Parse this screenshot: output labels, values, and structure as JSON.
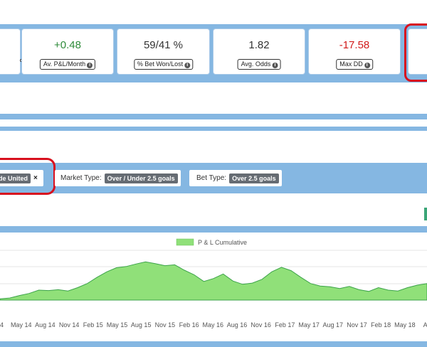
{
  "stats": [
    {
      "value": "",
      "label": ""
    },
    {
      "value": "+0.48",
      "label": "Av. P&L/Month",
      "tone": "green"
    },
    {
      "value": "59/41 %",
      "label": "% Bet Won/Lost",
      "tone": "neutral"
    },
    {
      "value": "1.82",
      "label": "Avg. Odds",
      "tone": "neutral"
    },
    {
      "value": "-17.58",
      "label": "Max DD",
      "tone": "red"
    }
  ],
  "filters": {
    "team": {
      "value": "de United",
      "remove": "×"
    },
    "market": {
      "label": "Market Type:",
      "value": "Over / Under 2.5 goals"
    },
    "bet": {
      "label": "Bet Type:",
      "value": "Over 2.5 goals"
    }
  },
  "colors": {
    "accent": "#85b7e2",
    "area_fill": "#90e079",
    "area_stroke": "#3ca34a",
    "positive": "#2e8b3a",
    "negative": "#d11a1a",
    "highlight": "#d8101e"
  },
  "chart_data": {
    "type": "area",
    "series": [
      {
        "name": "P & L Cumulative"
      }
    ],
    "x_ticks": [
      "4",
      "May 14",
      "Aug 14",
      "Nov 14",
      "Feb 15",
      "May 15",
      "Aug 15",
      "Nov 15",
      "Feb 16",
      "May 16",
      "Aug 16",
      "Nov 16",
      "Feb 17",
      "May 17",
      "Aug 17",
      "Nov 17",
      "Feb 18",
      "May 18",
      "Aug"
    ],
    "y": [
      0.3,
      0.5,
      1.1,
      1.6,
      2.4,
      2.3,
      2.5,
      2.2,
      3.0,
      4.0,
      5.5,
      6.8,
      7.8,
      8.1,
      8.7,
      9.2,
      8.8,
      8.3,
      8.5,
      7.2,
      6.1,
      4.5,
      5.2,
      6.3,
      4.6,
      3.8,
      4.1,
      5.0,
      6.8,
      7.9,
      7.1,
      5.5,
      4.0,
      3.4,
      3.2,
      2.8,
      3.3,
      2.5,
      2.1,
      3.0,
      2.4,
      2.2,
      3.0,
      3.6,
      4.0
    ],
    "grid": true
  }
}
